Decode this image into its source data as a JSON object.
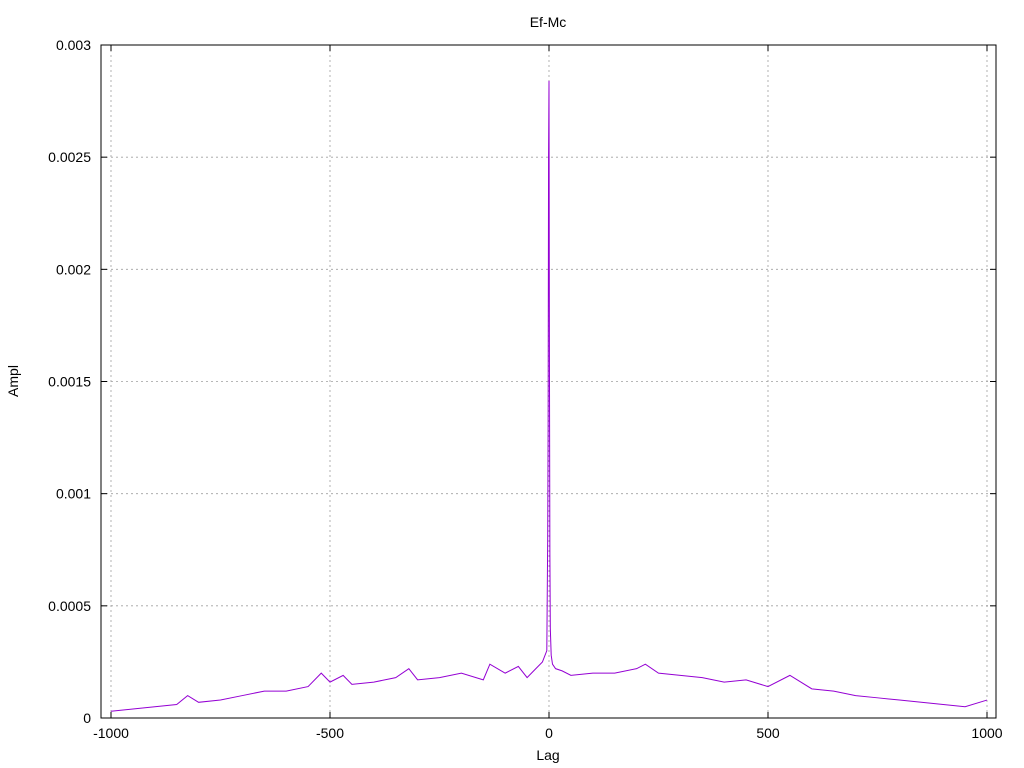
{
  "chart_data": {
    "type": "line",
    "title": "Ef-Mc",
    "xlabel": "Lag",
    "ylabel": "Ampl",
    "xlim": [
      -1000,
      1000
    ],
    "ylim": [
      0,
      0.003
    ],
    "x_ticks": [
      -1000,
      -500,
      0,
      500,
      1000
    ],
    "x_tick_labels": [
      "-1000",
      "-500",
      "0",
      "500",
      "1000"
    ],
    "y_ticks": [
      0,
      0.0005,
      0.001,
      0.0015,
      0.002,
      0.0025,
      0.003
    ],
    "y_tick_labels": [
      "0",
      "0.0005",
      "0.001",
      "0.0015",
      "0.002",
      "0.0025",
      "0.003"
    ],
    "grid": true,
    "legend": "none",
    "series": [
      {
        "color": "#9400d3",
        "x": [
          -1000,
          -950,
          -900,
          -850,
          -825,
          -800,
          -750,
          -700,
          -650,
          -600,
          -550,
          -520,
          -500,
          -470,
          -450,
          -400,
          -350,
          -320,
          -300,
          -250,
          -200,
          -150,
          -135,
          -100,
          -70,
          -50,
          -30,
          -15,
          -5,
          -3,
          -2,
          -1,
          0,
          1,
          2,
          3,
          5,
          8,
          15,
          30,
          50,
          100,
          150,
          200,
          220,
          250,
          300,
          350,
          400,
          450,
          500,
          550,
          600,
          650,
          700,
          750,
          800,
          850,
          900,
          950,
          1000
        ],
        "y": [
          3e-05,
          4e-05,
          5e-05,
          6e-05,
          0.0001,
          7e-05,
          8e-05,
          0.0001,
          0.00012,
          0.00012,
          0.00014,
          0.0002,
          0.00016,
          0.00019,
          0.00015,
          0.00016,
          0.00018,
          0.00022,
          0.00017,
          0.00018,
          0.0002,
          0.00017,
          0.00024,
          0.0002,
          0.00023,
          0.00018,
          0.00022,
          0.00025,
          0.0003,
          0.0008,
          0.0013,
          0.0025,
          0.00284,
          0.0016,
          0.00073,
          0.0004,
          0.00028,
          0.00024,
          0.00022,
          0.00021,
          0.00019,
          0.0002,
          0.0002,
          0.00022,
          0.00024,
          0.0002,
          0.00019,
          0.00018,
          0.00016,
          0.00017,
          0.00014,
          0.00019,
          0.00013,
          0.00012,
          0.0001,
          9e-05,
          8e-05,
          7e-05,
          6e-05,
          5e-05,
          8e-05
        ]
      }
    ]
  }
}
